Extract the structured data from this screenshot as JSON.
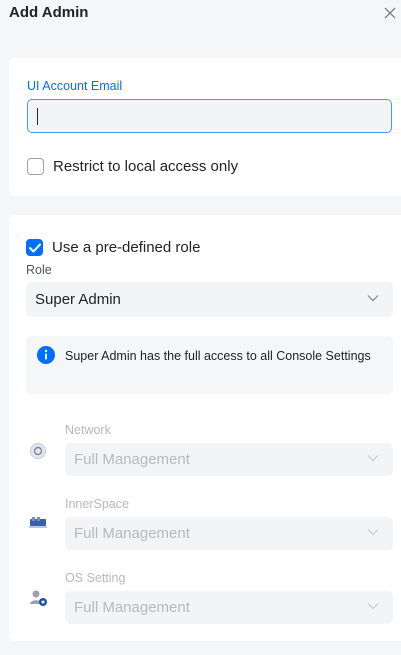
{
  "dialog": {
    "title": "Add Admin",
    "close_icon": "close-icon"
  },
  "account": {
    "email_label": "UI Account Email",
    "email_value": "",
    "restrict_label": "Restrict to local access only",
    "restrict_checked": false
  },
  "role_section": {
    "predefined_label": "Use a pre-defined role",
    "predefined_checked": true,
    "role_label": "Role",
    "role_value": "Super Admin",
    "info_text": "Super Admin has the full access to all Console Settings",
    "info_icon": "info-icon"
  },
  "permissions": [
    {
      "label": "Network",
      "value": "Full Management",
      "icon": "network-icon"
    },
    {
      "label": "InnerSpace",
      "value": "Full Management",
      "icon": "innerspace-icon"
    },
    {
      "label": "OS Setting",
      "value": "Full Management",
      "icon": "os-setting-icon"
    }
  ],
  "colors": {
    "accent": "#006fff",
    "background": "#f5f6f7",
    "card": "#ffffff",
    "muted_text": "#b6b9bd"
  }
}
